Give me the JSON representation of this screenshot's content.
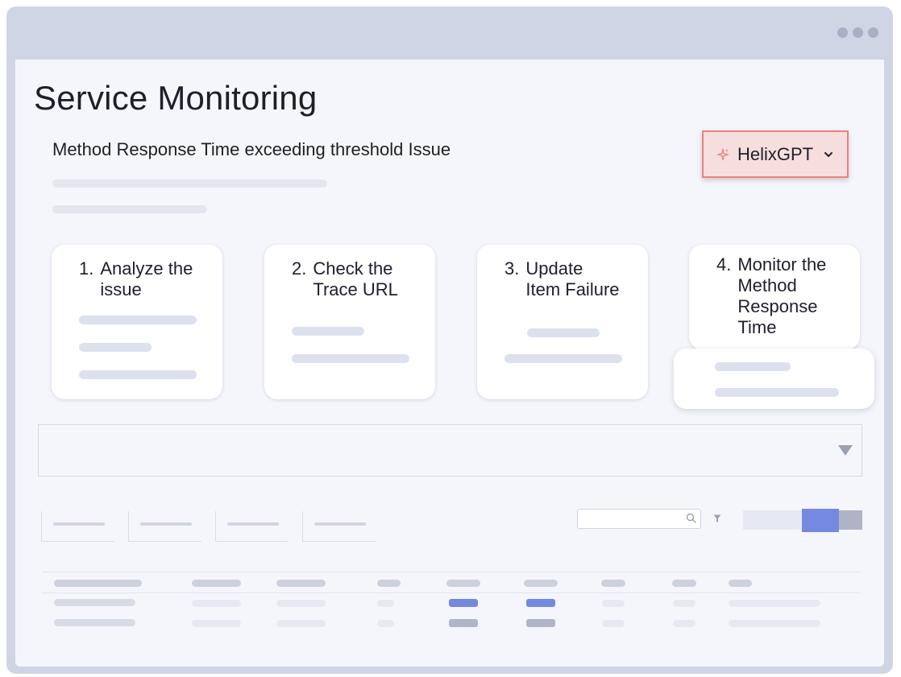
{
  "page": {
    "title": "Service Monitoring",
    "issue_title": "Method Response Time exceeding threshold Issue"
  },
  "helix": {
    "label": "HelixGPT",
    "icon": "sparkle-icon",
    "accent": "#e7837f",
    "bg": "#f7dede"
  },
  "steps": [
    {
      "num": "1.",
      "label": "Analyze the\nissue"
    },
    {
      "num": "2.",
      "label": "Check the\nTrace URL"
    },
    {
      "num": "3.",
      "label": "Update\nItem Failure"
    },
    {
      "num": "4.",
      "label": "Monitor the\nMethod\nResponse\nTime"
    }
  ],
  "colors": {
    "window_frame": "#cfd5e5",
    "content_bg": "#f5f6fc",
    "toggle_active": "#7589e0",
    "placeholder": "#dde1ee"
  },
  "icons": [
    "sparkle-icon",
    "chevron-down-icon",
    "caret-down-icon",
    "search-icon",
    "filter-icon"
  ]
}
